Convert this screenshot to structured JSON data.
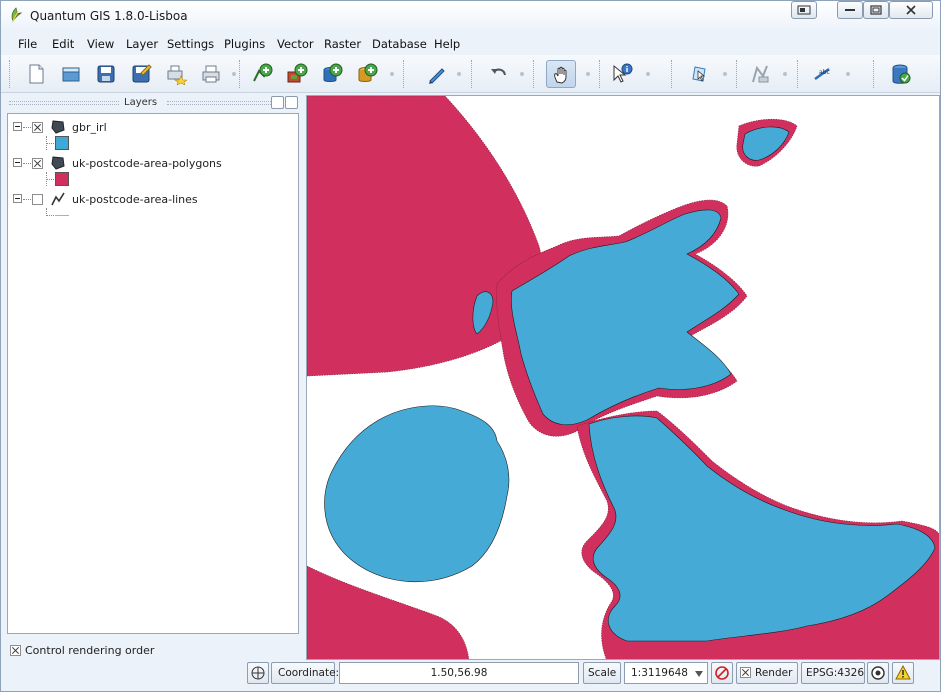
{
  "window": {
    "title": "Quantum GIS 1.8.0-Lisboa"
  },
  "menu": [
    "File",
    "Edit",
    "View",
    "Layer",
    "Settings",
    "Plugins",
    "Vector",
    "Raster",
    "Database",
    "Help"
  ],
  "toolbar": {
    "buttons": [
      {
        "icon": "new-project-icon",
        "interactable": true
      },
      {
        "icon": "open-project-icon",
        "interactable": true
      },
      {
        "icon": "save-project-icon",
        "interactable": true
      },
      {
        "icon": "save-as-icon",
        "interactable": true
      },
      {
        "icon": "print-composer-new-icon",
        "interactable": true
      },
      {
        "icon": "print-composer-manager-icon",
        "interactable": true
      },
      {
        "icon": "add-vector-layer-icon",
        "interactable": true
      },
      {
        "icon": "add-raster-layer-icon",
        "interactable": true
      },
      {
        "icon": "add-postgis-layer-icon",
        "interactable": true
      },
      {
        "icon": "add-spatialite-layer-icon",
        "interactable": true
      },
      {
        "icon": "toggle-editing-icon",
        "interactable": true
      },
      {
        "icon": "undo-icon",
        "interactable": true
      },
      {
        "icon": "pan-hand-icon",
        "interactable": true,
        "active": true
      },
      {
        "icon": "identify-icon",
        "interactable": true
      },
      {
        "icon": "select-feature-icon",
        "interactable": true
      },
      {
        "icon": "measure-icon",
        "interactable": true
      },
      {
        "icon": "label-tool-icon",
        "interactable": true
      },
      {
        "icon": "database-plugin-icon",
        "interactable": true
      }
    ]
  },
  "layers_panel": {
    "title": "Layers",
    "layers": [
      {
        "name": "gbr_irl",
        "checked": true,
        "type": "polygon",
        "color": "#3ea8d6"
      },
      {
        "name": "uk-postcode-area-polygons",
        "checked": true,
        "type": "polygon",
        "color": "#d1305e"
      },
      {
        "name": "uk-postcode-area-lines",
        "checked": false,
        "type": "line",
        "color": "#d8b33a"
      }
    ],
    "control_rendering_order": {
      "label": "Control rendering order",
      "checked": true
    }
  },
  "map": {
    "land_color": "#45aad6",
    "sea_poly_color": "#d1305e",
    "background": "#ffffff"
  },
  "status": {
    "coordinate_label": "Coordinate:",
    "coordinate_value": "1.50,56.98",
    "scale_label": "Scale",
    "scale_value": "1:3119648",
    "render_label": "Render",
    "render_checked": true,
    "crs": "EPSG:4326"
  }
}
